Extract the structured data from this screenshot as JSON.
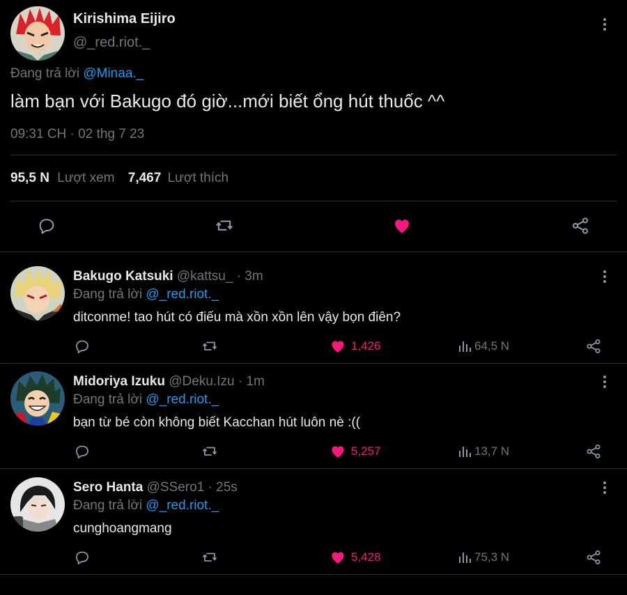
{
  "main_tweet": {
    "name": "Kirishima Eijiro",
    "handle": "@_red.riot._",
    "replying_prefix": "Đang trả lời",
    "replying_to": "@Minaa._",
    "text": "làm bạn với Bakugo đó giờ...mới biết ổng hút thuốc ^^",
    "timestamp": "09:31 CH · 02 thg 7 23",
    "views_count": "95,5 N",
    "views_label": "Lượt xem",
    "likes_count": "7,467",
    "likes_label": "Lượt thích",
    "liked": true
  },
  "colors": {
    "background": "#000000",
    "text": "#e7e9ea",
    "muted": "#71767b",
    "link": "#1d9bf0",
    "like": "#f91880",
    "divider": "#2f3336"
  },
  "replies": [
    {
      "name": "Bakugo Katsuki",
      "handle": "@kattsu_",
      "time": "· 3m",
      "replying_prefix": "Đang trả lời",
      "replying_to": "@_red.riot._",
      "text": "ditconme! tao hút có điếu mà xồn xồn lên vậy bọn điên?",
      "likes": "1,426",
      "views": "64,5 N",
      "avatar_icon": "bakugo-avatar"
    },
    {
      "name": "Midoriya Izuku",
      "handle": "@Deku.Izu",
      "time": "· 1m",
      "replying_prefix": "Đang trả lời",
      "replying_to": "@_red.riot._",
      "text": "bạn từ bé còn không biết Kacchan hút luôn nè :((",
      "likes": "5,257",
      "views": "13,7 N",
      "avatar_icon": "midoriya-avatar"
    },
    {
      "name": "Sero Hanta",
      "handle": "@SSero1",
      "time": "· 25s",
      "replying_prefix": "Đang trả lời",
      "replying_to": "@_red.riot._",
      "text": "cunghoangmang",
      "likes": "5,428",
      "views": "75,3 N",
      "avatar_icon": "sero-avatar"
    }
  ]
}
